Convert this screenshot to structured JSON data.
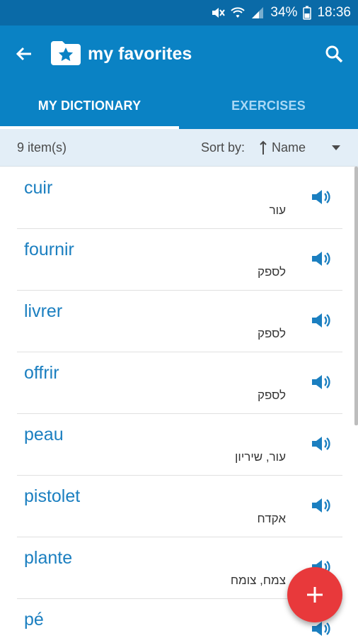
{
  "status_bar": {
    "battery": "34%",
    "time": "18:36"
  },
  "app_bar": {
    "title": "my favorites"
  },
  "tabs": [
    {
      "label": "MY DICTIONARY",
      "active": true
    },
    {
      "label": "EXERCISES",
      "active": false
    }
  ],
  "sort_bar": {
    "count": "9 item(s)",
    "sort_label": "Sort by:",
    "sort_value": "Name"
  },
  "items": [
    {
      "word": "cuir",
      "translation": "עור"
    },
    {
      "word": "fournir",
      "translation": "לספק"
    },
    {
      "word": "livrer",
      "translation": "לספק"
    },
    {
      "word": "offrir",
      "translation": "לספק"
    },
    {
      "word": "peau",
      "translation": "עור, שיריון"
    },
    {
      "word": "pistolet",
      "translation": "אקדח"
    },
    {
      "word": "plante",
      "translation": "צמח, צומח"
    },
    {
      "word": "pé",
      "translation": ""
    }
  ],
  "colors": {
    "status_bar": "#0a6aa7",
    "app_bar": "#0a82c4",
    "accent_text": "#1b7fc0",
    "fab": "#e8393b",
    "sort_bar": "#e3eef7"
  },
  "icons": [
    "mute-icon",
    "wifi-icon",
    "signal-icon",
    "battery-icon",
    "back-arrow-icon",
    "favorites-folder-icon",
    "search-icon",
    "sort-arrow-icon",
    "dropdown-icon",
    "speaker-icon",
    "plus-icon"
  ]
}
